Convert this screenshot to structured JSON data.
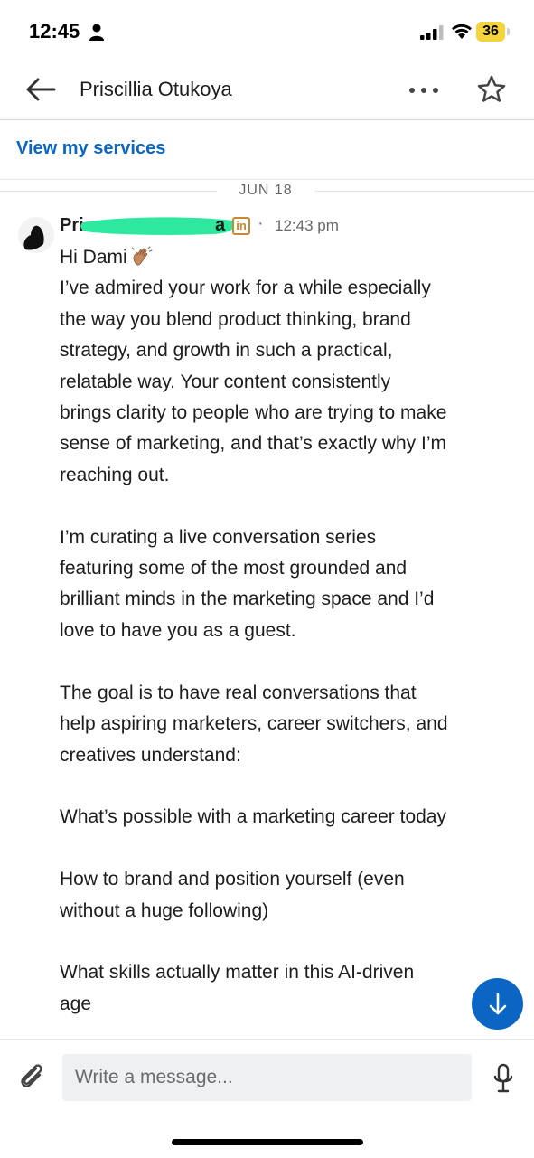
{
  "status_bar": {
    "time": "12:45",
    "battery_level": "36",
    "icons": [
      "person-icon",
      "signal-icon",
      "wifi-icon",
      "battery-icon"
    ]
  },
  "header": {
    "title": "Priscillia Otukoya",
    "icons": [
      "back-arrow-icon",
      "more-options-icon",
      "star-icon"
    ]
  },
  "services_link": "View my services",
  "date_divider": "JUN 18",
  "message": {
    "sender_start": "Pri",
    "sender_end": "a",
    "linkedin_badge": "in",
    "separator": "·",
    "time": "12:43 pm",
    "greeting": "Hi Dami",
    "lines": [
      "I’ve admired your work for a while especially",
      "the way you blend product thinking, brand",
      "strategy, and growth in such a practical,",
      "relatable way. Your content consistently",
      "brings clarity to people who are trying to make",
      "sense of marketing, and that’s exactly why I’m",
      "reaching out.",
      "",
      "I’m curating a live conversation series",
      "featuring some of the most grounded and",
      "brilliant minds in the marketing space and I’d",
      "love to have you as a guest.",
      "",
      "The goal is to have real conversations that",
      "help aspiring marketers, career switchers, and",
      "creatives understand:",
      "",
      "What’s possible with a marketing career today",
      "",
      "How to brand and position yourself (even",
      "without a huge following)",
      "",
      "What skills actually matter in this AI-driven",
      "age"
    ]
  },
  "composer": {
    "placeholder": "Write a message...",
    "icons": [
      "paperclip-icon",
      "microphone-icon"
    ]
  },
  "colors": {
    "accent": "#0a66c2",
    "battery": "#f5d33a",
    "redaction": "#2fe8a0",
    "linkedin_badge": "#c9892f"
  }
}
